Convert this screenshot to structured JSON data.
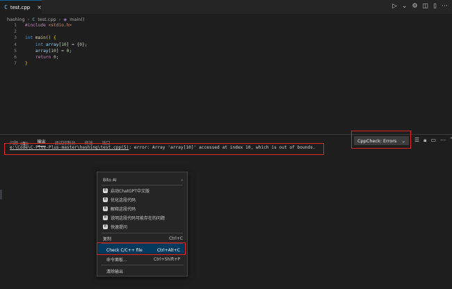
{
  "tab": {
    "icon": "C",
    "name": "test.cpp",
    "close": "×"
  },
  "breadcrumb": {
    "folder": "hashing",
    "file": "test.cpp",
    "symbol": "main()"
  },
  "code": [
    {
      "ln": "1",
      "parts": [
        [
          "kw2",
          "#include "
        ],
        [
          "str",
          "<stdio.h>"
        ]
      ]
    },
    {
      "ln": "2",
      "parts": []
    },
    {
      "ln": "3",
      "parts": [
        [
          "kw",
          "int "
        ],
        [
          "fn",
          "main"
        ],
        [
          "br",
          "() {"
        ]
      ]
    },
    {
      "ln": "4",
      "parts": [
        [
          "pl",
          "    "
        ],
        [
          "kw",
          "int "
        ],
        [
          "id",
          "array"
        ],
        [
          "pl",
          "["
        ],
        [
          "num",
          "10"
        ],
        [
          "pl",
          "] = {"
        ],
        [
          "num",
          "0"
        ],
        [
          "pl",
          "};"
        ]
      ]
    },
    {
      "ln": "5",
      "parts": [
        [
          "pl",
          "    "
        ],
        [
          "id",
          "array"
        ],
        [
          "pl",
          "["
        ],
        [
          "num",
          "10"
        ],
        [
          "pl",
          "] = "
        ],
        [
          "num",
          "0"
        ],
        [
          "pl",
          ";"
        ]
      ]
    },
    {
      "ln": "6",
      "parts": [
        [
          "pl",
          "    "
        ],
        [
          "kw2",
          "return "
        ],
        [
          "num",
          "0"
        ],
        [
          "pl",
          ";"
        ]
      ]
    },
    {
      "ln": "7",
      "parts": [
        [
          "br",
          "}"
        ]
      ]
    }
  ],
  "panel": {
    "tabs": [
      "问题",
      "输出",
      "调试控制台",
      "终端",
      "端口"
    ],
    "problems_count": "1",
    "active_tab_index": 1,
    "output_channel": "CppCheck: Errors",
    "output_path": "e:\\Code\\C-Plus-Plus-master\\hashing\\test.cpp(5)",
    "output_message": ": error: Array 'array[10]' accessed at index 10, which is out of bounds."
  },
  "context_menu": {
    "bito_header": "Bito AI",
    "bito_items": [
      "启动ChatGPT中文版",
      "优化这段代码",
      "解释这段代码",
      "说明这段代码可能存在的问题",
      "快速提问"
    ],
    "copy": {
      "label": "复制",
      "shortcut": "Ctrl+C"
    },
    "check": {
      "label": "Check C/C++ file",
      "shortcut": "Ctrl+Alt+C"
    },
    "command_palette": {
      "label": "命令面板...",
      "shortcut": "Ctrl+Shift+P"
    },
    "clear_output": {
      "label": "清除输出"
    }
  },
  "colors": {
    "accent": "#0e639c",
    "highlight_border": "#e0252a",
    "menu_selected": "#04395e"
  }
}
